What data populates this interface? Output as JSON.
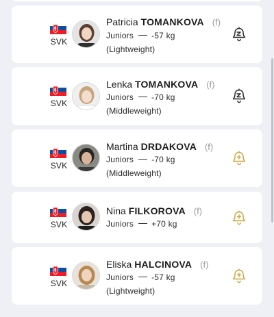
{
  "colors": {
    "background": "#eef0f6",
    "card": "#ffffff",
    "bell_following": "#222222",
    "bell_add": "#c9a33a"
  },
  "athletes": [
    {
      "country": "SVK",
      "first_name": "Patricia",
      "last_name": "TOMANKOVA",
      "gender": "(f)",
      "category": "Juniors",
      "weight": "-57 kg",
      "weight_class": "(Lightweight)",
      "bell_icon": "bell-off-icon"
    },
    {
      "country": "SVK",
      "first_name": "Lenka",
      "last_name": "TOMANKOVA",
      "gender": "(f)",
      "category": "Juniors",
      "weight": "-70 kg",
      "weight_class": "(Middleweight)",
      "bell_icon": "bell-off-icon"
    },
    {
      "country": "SVK",
      "first_name": "Martina",
      "last_name": "DRDAKOVA",
      "gender": "(f)",
      "category": "Juniors",
      "weight": "-70 kg",
      "weight_class": "(Middleweight)",
      "bell_icon": "bell-plus-icon"
    },
    {
      "country": "SVK",
      "first_name": "Nina",
      "last_name": "FILKOROVA",
      "gender": "(f)",
      "category": "Juniors",
      "weight": "+70 kg",
      "weight_class": "",
      "bell_icon": "bell-plus-icon"
    },
    {
      "country": "SVK",
      "first_name": "Eliska",
      "last_name": "HALCINOVA",
      "gender": "(f)",
      "category": "Juniors",
      "weight": "-57 kg",
      "weight_class": "(Lightweight)",
      "bell_icon": "bell-plus-icon"
    }
  ]
}
